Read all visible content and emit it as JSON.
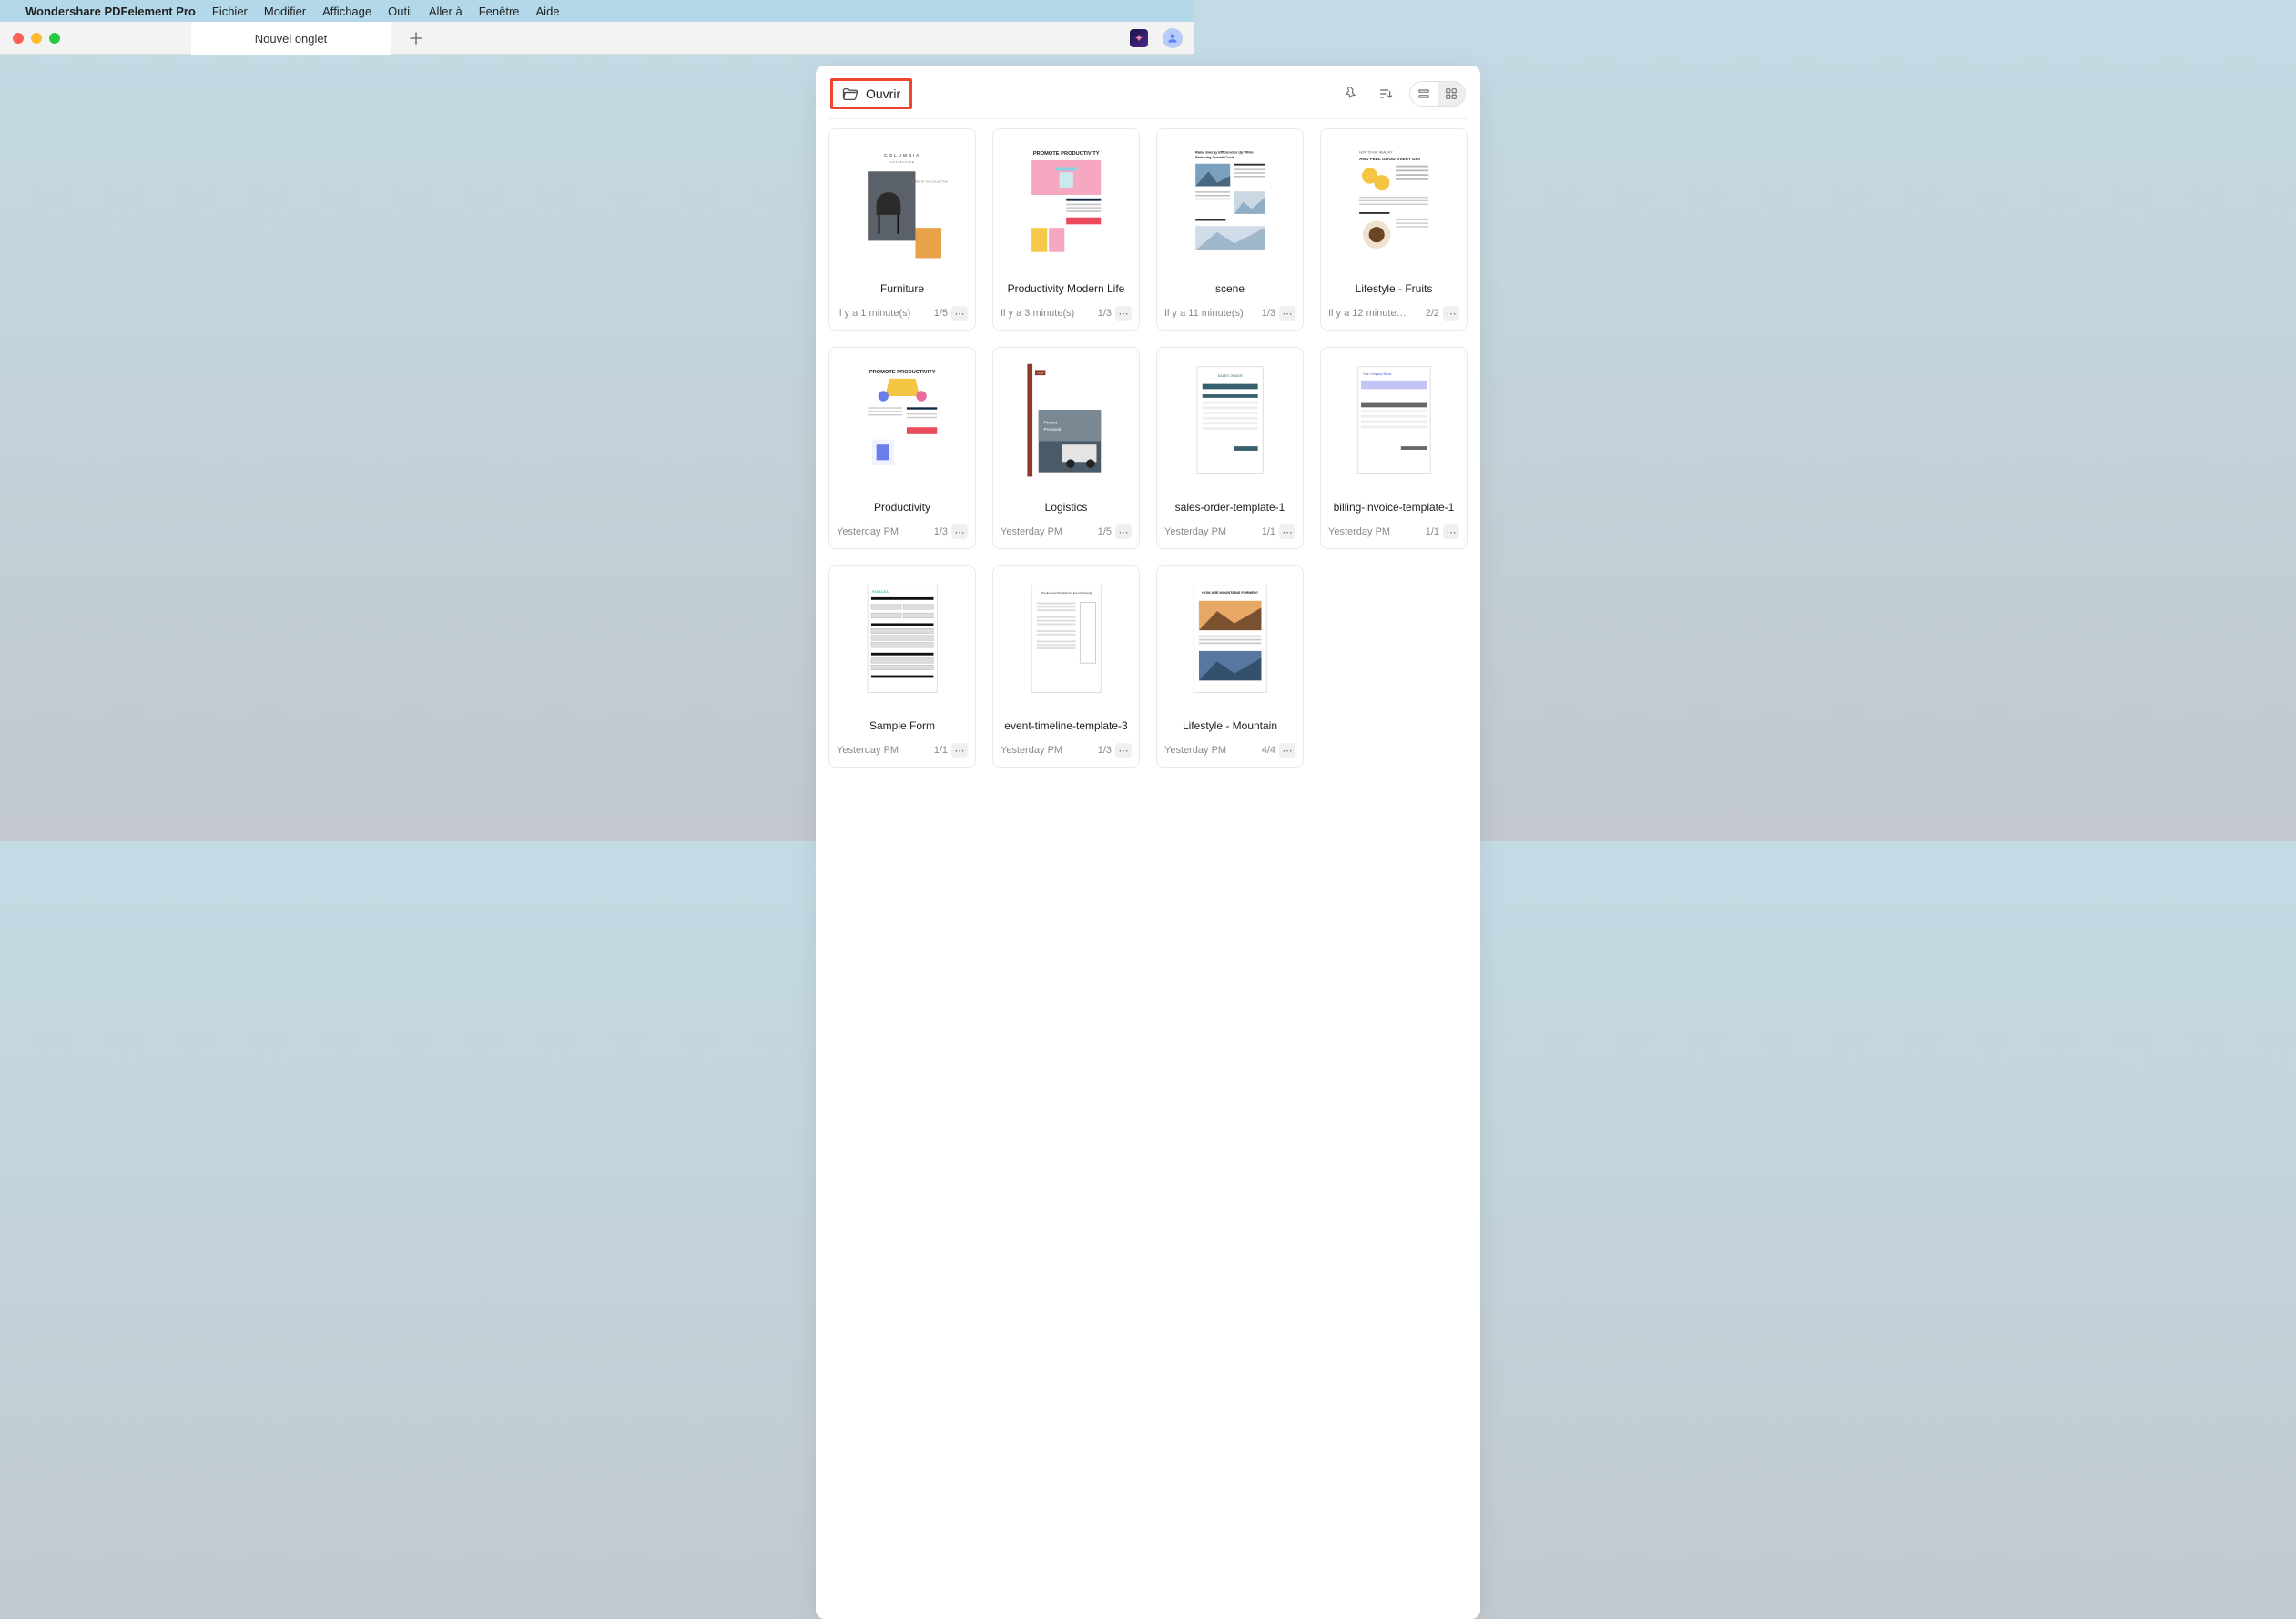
{
  "menubar": {
    "app_name": "Wondershare PDFelement Pro",
    "items": [
      "Fichier",
      "Modifier",
      "Affichage",
      "Outil",
      "Aller à",
      "Fenêtre",
      "Aide"
    ]
  },
  "tab": {
    "label": "Nouvel onglet"
  },
  "toolbar": {
    "open_label": "Ouvrir"
  },
  "documents": [
    {
      "title": "Furniture",
      "time": "Il y a 1 minute(s)",
      "pages": "1/5"
    },
    {
      "title": "Productivity Modern Life",
      "time": "Il y a 3 minute(s)",
      "pages": "1/3"
    },
    {
      "title": "scene",
      "time": "Il y a 11 minute(s)",
      "pages": "1/3"
    },
    {
      "title": "Lifestyle - Fruits",
      "time": "Il y a 12 minute…",
      "pages": "2/2"
    },
    {
      "title": "Productivity",
      "time": "Yesterday PM",
      "pages": "1/3"
    },
    {
      "title": "Logistics",
      "time": "Yesterday PM",
      "pages": "1/5"
    },
    {
      "title": "sales-order-template-1",
      "time": "Yesterday PM",
      "pages": "1/1"
    },
    {
      "title": "billing-invoice-template-1",
      "time": "Yesterday PM",
      "pages": "1/1"
    },
    {
      "title": "Sample Form",
      "time": "Yesterday PM",
      "pages": "1/1"
    },
    {
      "title": "event-timeline-template-3",
      "time": "Yesterday PM",
      "pages": "1/3"
    },
    {
      "title": "Lifestyle - Mountain",
      "time": "Yesterday PM",
      "pages": "4/4"
    }
  ],
  "thumb_text": {
    "furniture": {
      "line1": "COLUMBIA",
      "line2": "COLLECTIVE",
      "caption": "INSPIRED BY THE COLLECTIVE."
    },
    "productivity_modern": {
      "heading": "PROMOTE PRODUCTIVITY"
    },
    "scene": {
      "title1": "Raise Energy Efficiencies Up While",
      "title2": "Reducing Overall Costs"
    },
    "fruits": {
      "small": "HOW TO EAT HEALTHY",
      "big": "AND FEEL GOOD EVERY DAY"
    },
    "productivity": {
      "heading": "PROMOTE PRODUCTIVITY"
    },
    "logistics": {
      "badge": "LOS",
      "line1": "Project",
      "line2": "Proposal"
    },
    "sales": {
      "title": "SALES ORDER"
    },
    "invoice": {
      "title": "Your Company Name"
    },
    "sample_form": {
      "title": "PANACEA"
    },
    "event": {
      "title": "Timeline and Checklist for Event Planning"
    },
    "mountain": {
      "title": "HOW ARE MOUNTAINS FORMED?"
    }
  }
}
